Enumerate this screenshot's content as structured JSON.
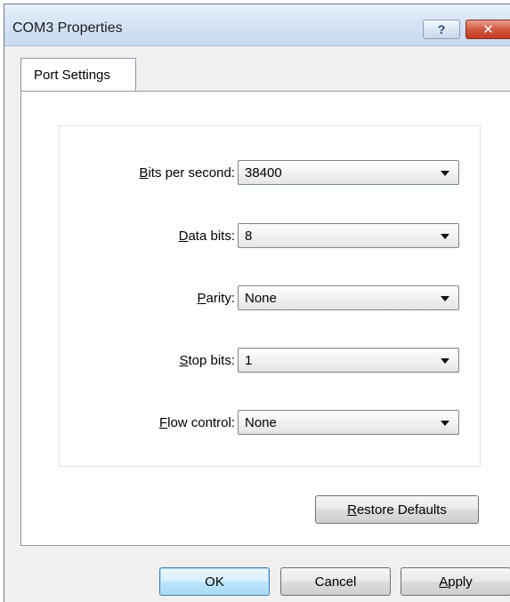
{
  "window": {
    "title": "COM3 Properties",
    "help_label": "?",
    "close_label": "✕"
  },
  "tabs": [
    {
      "label": "Port Settings",
      "selected": true
    }
  ],
  "fields": [
    {
      "mnemonic": "B",
      "rest": "its per second:",
      "value": "38400"
    },
    {
      "mnemonic": "D",
      "rest": "ata bits:",
      "value": "8"
    },
    {
      "mnemonic": "P",
      "rest": "arity:",
      "value": "None"
    },
    {
      "mnemonic": "S",
      "rest": "top bits:",
      "value": "1"
    },
    {
      "mnemonic": "F",
      "rest": "low control:",
      "value": "None"
    }
  ],
  "buttons": {
    "restore": {
      "mnemonic": "R",
      "rest": "estore Defaults"
    },
    "ok": "OK",
    "cancel": "Cancel",
    "apply": {
      "mnemonic": "A",
      "rest": "pply"
    }
  },
  "colors": {
    "titlebar": "#d6e4f5",
    "close_button": "#c23a23",
    "default_button": "#bee6fd"
  }
}
